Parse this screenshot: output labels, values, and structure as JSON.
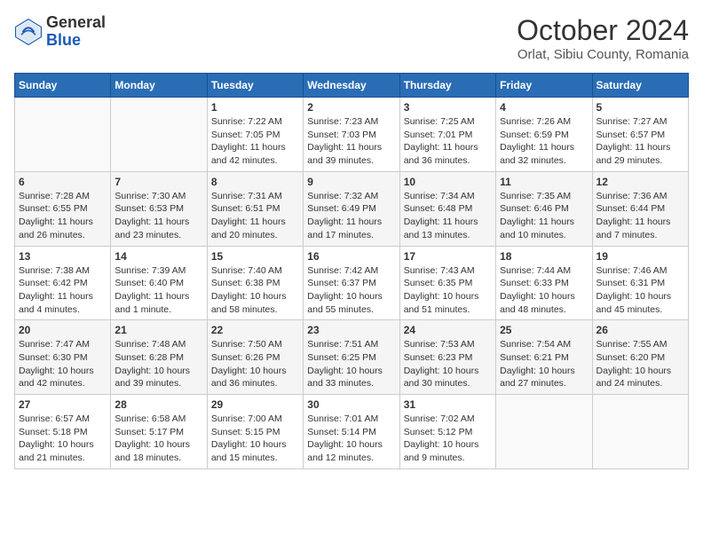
{
  "header": {
    "logo_general": "General",
    "logo_blue": "Blue",
    "month": "October 2024",
    "location": "Orlat, Sibiu County, Romania"
  },
  "days_of_week": [
    "Sunday",
    "Monday",
    "Tuesday",
    "Wednesday",
    "Thursday",
    "Friday",
    "Saturday"
  ],
  "weeks": [
    [
      {
        "day": "",
        "content": ""
      },
      {
        "day": "",
        "content": ""
      },
      {
        "day": "1",
        "content": "Sunrise: 7:22 AM\nSunset: 7:05 PM\nDaylight: 11 hours and 42 minutes."
      },
      {
        "day": "2",
        "content": "Sunrise: 7:23 AM\nSunset: 7:03 PM\nDaylight: 11 hours and 39 minutes."
      },
      {
        "day": "3",
        "content": "Sunrise: 7:25 AM\nSunset: 7:01 PM\nDaylight: 11 hours and 36 minutes."
      },
      {
        "day": "4",
        "content": "Sunrise: 7:26 AM\nSunset: 6:59 PM\nDaylight: 11 hours and 32 minutes."
      },
      {
        "day": "5",
        "content": "Sunrise: 7:27 AM\nSunset: 6:57 PM\nDaylight: 11 hours and 29 minutes."
      }
    ],
    [
      {
        "day": "6",
        "content": "Sunrise: 7:28 AM\nSunset: 6:55 PM\nDaylight: 11 hours and 26 minutes."
      },
      {
        "day": "7",
        "content": "Sunrise: 7:30 AM\nSunset: 6:53 PM\nDaylight: 11 hours and 23 minutes."
      },
      {
        "day": "8",
        "content": "Sunrise: 7:31 AM\nSunset: 6:51 PM\nDaylight: 11 hours and 20 minutes."
      },
      {
        "day": "9",
        "content": "Sunrise: 7:32 AM\nSunset: 6:49 PM\nDaylight: 11 hours and 17 minutes."
      },
      {
        "day": "10",
        "content": "Sunrise: 7:34 AM\nSunset: 6:48 PM\nDaylight: 11 hours and 13 minutes."
      },
      {
        "day": "11",
        "content": "Sunrise: 7:35 AM\nSunset: 6:46 PM\nDaylight: 11 hours and 10 minutes."
      },
      {
        "day": "12",
        "content": "Sunrise: 7:36 AM\nSunset: 6:44 PM\nDaylight: 11 hours and 7 minutes."
      }
    ],
    [
      {
        "day": "13",
        "content": "Sunrise: 7:38 AM\nSunset: 6:42 PM\nDaylight: 11 hours and 4 minutes."
      },
      {
        "day": "14",
        "content": "Sunrise: 7:39 AM\nSunset: 6:40 PM\nDaylight: 11 hours and 1 minute."
      },
      {
        "day": "15",
        "content": "Sunrise: 7:40 AM\nSunset: 6:38 PM\nDaylight: 10 hours and 58 minutes."
      },
      {
        "day": "16",
        "content": "Sunrise: 7:42 AM\nSunset: 6:37 PM\nDaylight: 10 hours and 55 minutes."
      },
      {
        "day": "17",
        "content": "Sunrise: 7:43 AM\nSunset: 6:35 PM\nDaylight: 10 hours and 51 minutes."
      },
      {
        "day": "18",
        "content": "Sunrise: 7:44 AM\nSunset: 6:33 PM\nDaylight: 10 hours and 48 minutes."
      },
      {
        "day": "19",
        "content": "Sunrise: 7:46 AM\nSunset: 6:31 PM\nDaylight: 10 hours and 45 minutes."
      }
    ],
    [
      {
        "day": "20",
        "content": "Sunrise: 7:47 AM\nSunset: 6:30 PM\nDaylight: 10 hours and 42 minutes."
      },
      {
        "day": "21",
        "content": "Sunrise: 7:48 AM\nSunset: 6:28 PM\nDaylight: 10 hours and 39 minutes."
      },
      {
        "day": "22",
        "content": "Sunrise: 7:50 AM\nSunset: 6:26 PM\nDaylight: 10 hours and 36 minutes."
      },
      {
        "day": "23",
        "content": "Sunrise: 7:51 AM\nSunset: 6:25 PM\nDaylight: 10 hours and 33 minutes."
      },
      {
        "day": "24",
        "content": "Sunrise: 7:53 AM\nSunset: 6:23 PM\nDaylight: 10 hours and 30 minutes."
      },
      {
        "day": "25",
        "content": "Sunrise: 7:54 AM\nSunset: 6:21 PM\nDaylight: 10 hours and 27 minutes."
      },
      {
        "day": "26",
        "content": "Sunrise: 7:55 AM\nSunset: 6:20 PM\nDaylight: 10 hours and 24 minutes."
      }
    ],
    [
      {
        "day": "27",
        "content": "Sunrise: 6:57 AM\nSunset: 5:18 PM\nDaylight: 10 hours and 21 minutes."
      },
      {
        "day": "28",
        "content": "Sunrise: 6:58 AM\nSunset: 5:17 PM\nDaylight: 10 hours and 18 minutes."
      },
      {
        "day": "29",
        "content": "Sunrise: 7:00 AM\nSunset: 5:15 PM\nDaylight: 10 hours and 15 minutes."
      },
      {
        "day": "30",
        "content": "Sunrise: 7:01 AM\nSunset: 5:14 PM\nDaylight: 10 hours and 12 minutes."
      },
      {
        "day": "31",
        "content": "Sunrise: 7:02 AM\nSunset: 5:12 PM\nDaylight: 10 hours and 9 minutes."
      },
      {
        "day": "",
        "content": ""
      },
      {
        "day": "",
        "content": ""
      }
    ]
  ]
}
